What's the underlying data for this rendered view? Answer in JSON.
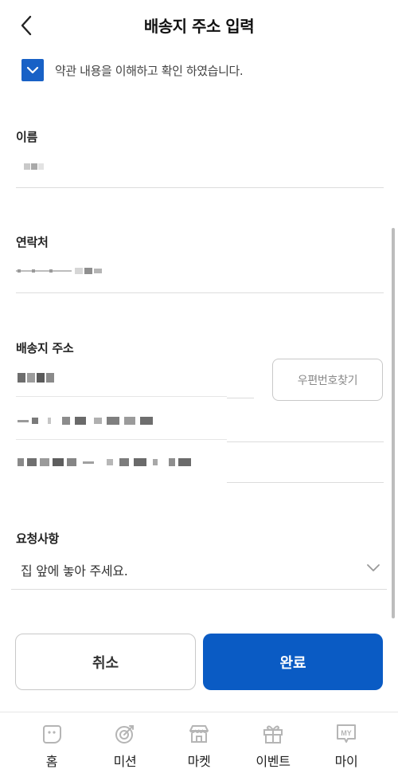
{
  "header": {
    "title": "배송지 주소 입력"
  },
  "agreement": {
    "checked": true,
    "text": "약관 내용을 이해하고 확인 하였습니다."
  },
  "form": {
    "name": {
      "label": "이름"
    },
    "phone": {
      "label": "연락처"
    },
    "address": {
      "label": "배송지 주소",
      "postcode_button": "우편번호찾기"
    },
    "request": {
      "label": "요청사항",
      "selected": "집 앞에 놓아 주세요."
    }
  },
  "actions": {
    "cancel": "취소",
    "done": "완료"
  },
  "tabbar": {
    "items": [
      {
        "label": "홈",
        "icon": "home-icon"
      },
      {
        "label": "미션",
        "icon": "mission-icon"
      },
      {
        "label": "마켓",
        "icon": "market-icon"
      },
      {
        "label": "이벤트",
        "icon": "event-gift-icon"
      },
      {
        "label": "마이",
        "icon": "my-icon",
        "icon_text": "MY"
      }
    ]
  },
  "colors": {
    "primary": "#0a5bc4",
    "checkbox": "#1861c6",
    "divider": "#dcdcdc"
  }
}
